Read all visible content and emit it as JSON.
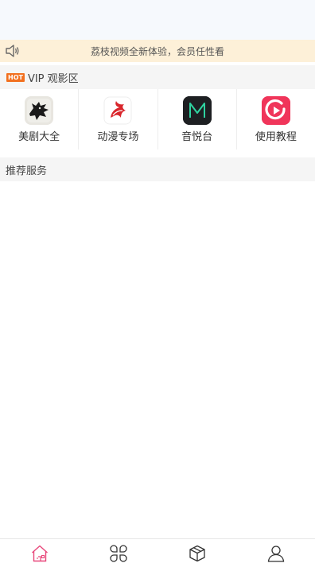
{
  "notice": {
    "text": "荔枝视频全新体验，会员任性看",
    "icon": "speaker-icon"
  },
  "vip_section": {
    "badge": "HOT",
    "title": "VIP 观影区",
    "badge_color": "#f2701f"
  },
  "apps": [
    {
      "label": "美剧大全",
      "icon": "wolf-icon"
    },
    {
      "label": "动漫专场",
      "icon": "fairy-tail-icon"
    },
    {
      "label": "音悦台",
      "icon": "m-icon"
    },
    {
      "label": "使用教程",
      "icon": "play-icon"
    }
  ],
  "recommend_section": {
    "title": "推荐服务"
  },
  "tabbar": {
    "active_color": "#e8467a",
    "tabs": [
      {
        "icon": "home-icon",
        "active": true
      },
      {
        "icon": "apps-icon",
        "active": false
      },
      {
        "icon": "box-icon",
        "active": false
      },
      {
        "icon": "user-icon",
        "active": false
      }
    ]
  }
}
